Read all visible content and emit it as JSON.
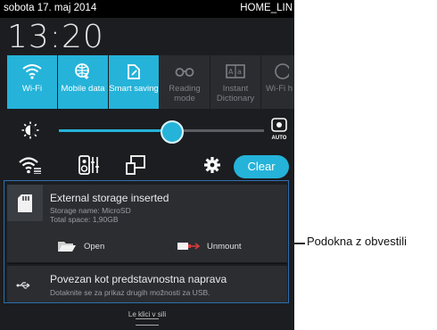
{
  "statusbar": {
    "date": "sobota 17. maj 2014",
    "network": "HOME_LIN"
  },
  "clock": "13:20",
  "quick_settings": [
    {
      "label": "Wi-Fi",
      "icon": "wifi-icon",
      "on": true
    },
    {
      "label": "Mobile data",
      "icon": "mobile-data-icon",
      "on": true
    },
    {
      "label": "Smart saving",
      "icon": "smart-saving-icon",
      "on": true
    },
    {
      "label": "Reading mode",
      "icon": "reading-mode-icon",
      "on": false
    },
    {
      "label": "Instant Dictionary",
      "icon": "dictionary-icon",
      "on": false
    },
    {
      "label": "Wi-Fi h",
      "icon": "wifi-hotspot-icon",
      "on": false
    }
  ],
  "brightness": {
    "level": 0.55,
    "auto_label": "AUTO"
  },
  "toggles": {
    "clear_label": "Clear"
  },
  "notifications": {
    "storage": {
      "title": "External storage inserted",
      "storage_name": "Storage name: MicroSD",
      "total_space": "Total space: 1,90GB",
      "open_label": "Open",
      "unmount_label": "Unmount"
    },
    "usb": {
      "title": "Povezan kot predstavnostna naprava",
      "subtitle": "Dotaknite se za prikaz drugih možnosti za USB."
    }
  },
  "bottom_hint": "Le klici v sili",
  "callout": "Podokna z obvestili",
  "colors": {
    "accent": "#25b3d9",
    "callout_border": "#2f6fb0"
  }
}
